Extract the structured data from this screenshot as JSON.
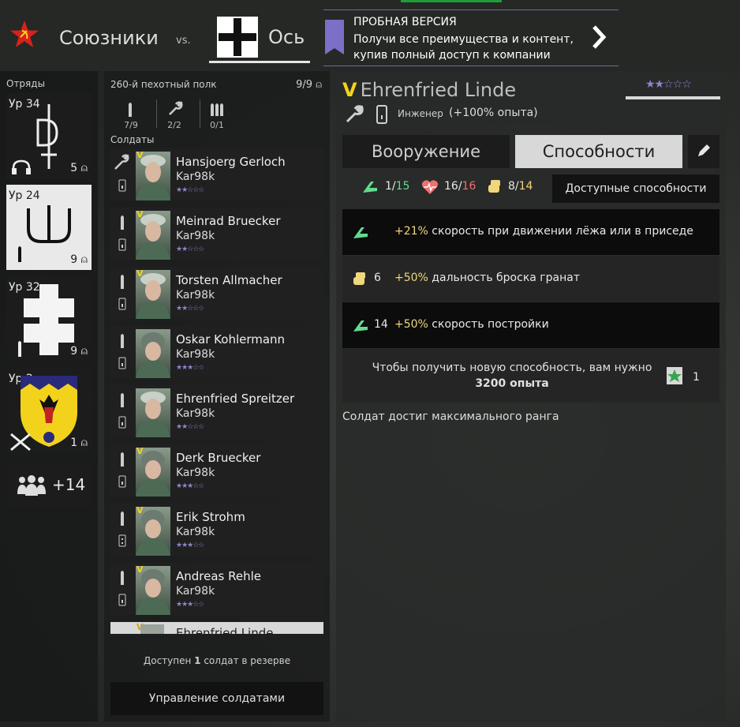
{
  "colors": {
    "accent_green": "#62dc8e",
    "accent_red": "#f07070",
    "accent_yellow": "#f1d77c",
    "rank_stars": "#8c86cc",
    "veteran_mark": "#f3d21c",
    "tab_selected_bg": "#d8d8d8"
  },
  "header": {
    "allies_label": "Союзники",
    "vs_label": "vs.",
    "axis_label": "Ось",
    "trial_title": "ПРОБНАЯ ВЕРСИЯ",
    "trial_text": "Получи все преимущества и контент, купив полный доступ к компании"
  },
  "squads": {
    "label": "Отряды",
    "cards": [
      {
        "level": "Ур 34",
        "count": "5"
      },
      {
        "level": "Ур 24",
        "count": "9"
      },
      {
        "level": "Ур 32",
        "count": "9"
      },
      {
        "level": "Ур 2",
        "count": "1"
      }
    ],
    "more_label": "+14"
  },
  "roster": {
    "regiment": "260-й пехотный полк",
    "count": "9/9",
    "class_counts": [
      "7/9",
      "2/2",
      "0/1"
    ],
    "soldiers_label": "Солдаты",
    "soldiers": [
      {
        "name": "Hansjoerg Gerloch",
        "weapon": "Kar98k",
        "stars": "★★☆☆☆",
        "veteran": "V"
      },
      {
        "name": "Meinrad Bruecker",
        "weapon": "Kar98k",
        "stars": "★★☆☆☆",
        "veteran": "V"
      },
      {
        "name": "Torsten Allmacher",
        "weapon": "Kar98k",
        "stars": "★★☆☆☆",
        "veteran": "V"
      },
      {
        "name": "Oskar Kohlermann",
        "weapon": "Kar98k",
        "stars": "★★★☆☆",
        "veteran": ""
      },
      {
        "name": "Ehrenfried Spreitzer",
        "weapon": "Kar98k",
        "stars": "★★☆☆☆",
        "veteran": ""
      },
      {
        "name": "Derk Bruecker",
        "weapon": "Kar98k",
        "stars": "★★★☆☆",
        "veteran": "V"
      },
      {
        "name": "Erik Strohm",
        "weapon": "Kar98k",
        "stars": "★★★☆☆",
        "veteran": "V"
      },
      {
        "name": "Andreas Rehle",
        "weapon": "Kar98k",
        "stars": "★★★☆☆",
        "veteran": "V"
      },
      {
        "name": "Ehrenfried Linde",
        "weapon": "",
        "stars": "",
        "veteran": "V"
      }
    ],
    "reserve_prefix": "Доступен ",
    "reserve_count": "1",
    "reserve_suffix": " солдат в резерве",
    "manage_label": "Управление солдатами"
  },
  "detail": {
    "veteran": "V",
    "name": "Ehrenfried Linde",
    "rank_stars": "★★☆☆☆",
    "class_name": "Инженер",
    "exp_bonus": "(+100% опыта)",
    "tab_weapons": "Вооружение",
    "tab_abilities": "Способности",
    "stats": {
      "speed_cur": "1",
      "speed_max": "15",
      "health_cur": "16",
      "health_max": "16",
      "strength_cur": "8",
      "strength_max": "14"
    },
    "available_abilities_label": "Доступные способности",
    "abilities": [
      {
        "level": "",
        "pct": "+21%",
        "text": " скорость при движении лёжа или в приседе"
      },
      {
        "level": "6",
        "pct": "+50%",
        "text": " дальность броска гранат"
      },
      {
        "level": "14",
        "pct": "+50%",
        "text": " скорость постройки"
      }
    ],
    "next_ability_text": "Чтобы получить новую способность, вам нужно",
    "next_ability_exp": "3200 опыта",
    "next_ability_cost": "1",
    "max_rank_text": "Солдат достиг максимального ранга"
  }
}
